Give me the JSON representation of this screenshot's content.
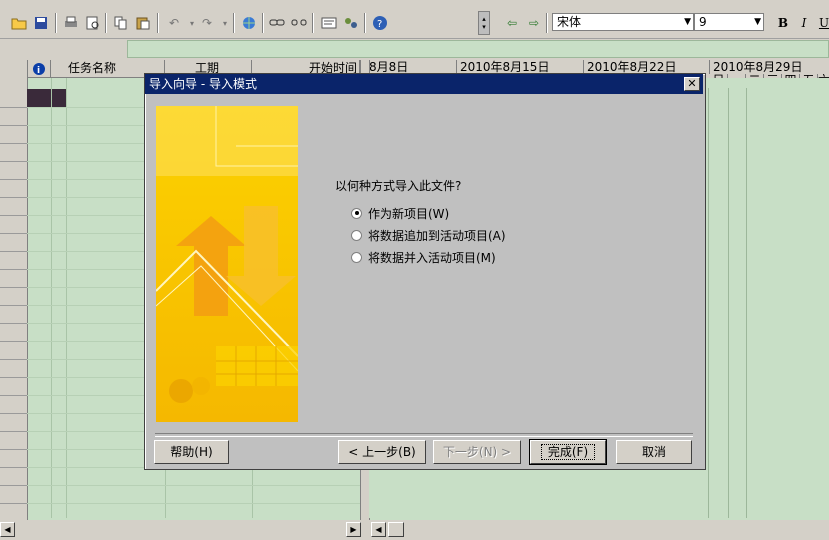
{
  "toolbar": {
    "font_name": "宋体",
    "font_size": "9",
    "bold": "B",
    "italic": "I",
    "underline": "U"
  },
  "table": {
    "info_col": "i",
    "columns": [
      "任务名称",
      "工期",
      "开始时间"
    ],
    "date_headers": [
      "8月8日",
      "2010年8月15日",
      "2010年8月22日",
      "2010年8月29日"
    ],
    "weekday_headers": [
      "日",
      "一",
      "二",
      "三",
      "四",
      "五",
      "六"
    ]
  },
  "dialog": {
    "title": "导入向导 - 导入模式",
    "close": "✕",
    "question": "以何种方式导入此文件?",
    "options": [
      {
        "label": "作为新项目(W)",
        "checked": true
      },
      {
        "label": "将数据追加到活动项目(A)",
        "checked": false
      },
      {
        "label": "将数据并入活动项目(M)",
        "checked": false
      }
    ],
    "buttons": {
      "help": "帮助(H)",
      "back": "< 上一步(B)",
      "next": "下一步(N) >",
      "finish": "完成(F)",
      "cancel": "取消"
    }
  },
  "colors": {
    "title_bar": "#0a246a",
    "sheet_bg": "#c8dfc6",
    "dialog_bg": "#c0c0c0",
    "art_yellow": "#fcd200"
  }
}
